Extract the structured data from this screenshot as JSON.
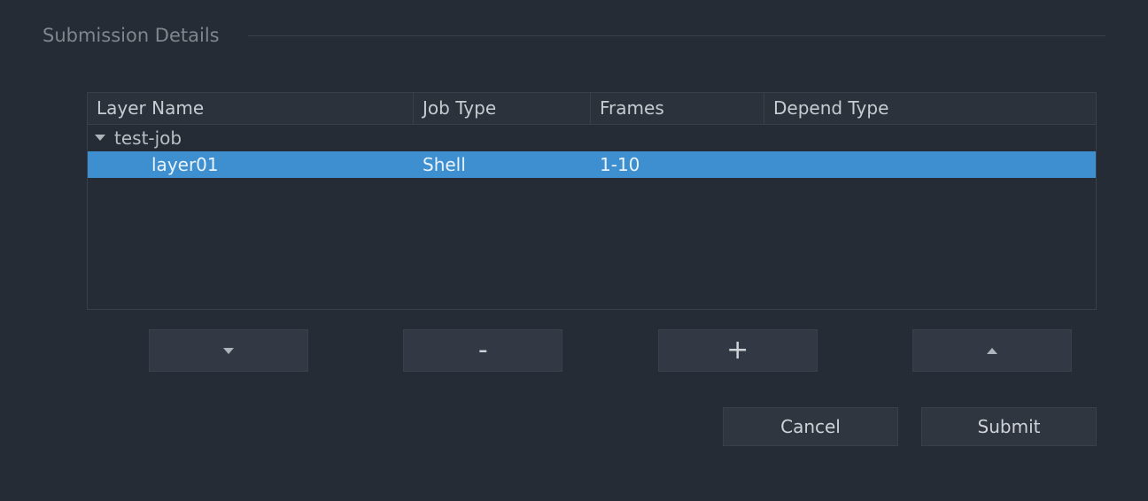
{
  "group_title": "Submission Details",
  "columns": {
    "name": "Layer Name",
    "type": "Job Type",
    "frames": "Frames",
    "depend": "Depend Type"
  },
  "rows": {
    "parent": {
      "name": "test-job",
      "type": "",
      "frames": "",
      "depend": ""
    },
    "child": {
      "name": "layer01",
      "type": "Shell",
      "frames": "1-10",
      "depend": ""
    }
  },
  "toolbar": {
    "minus": "-",
    "plus": "+"
  },
  "actions": {
    "cancel": "Cancel",
    "submit": "Submit"
  }
}
